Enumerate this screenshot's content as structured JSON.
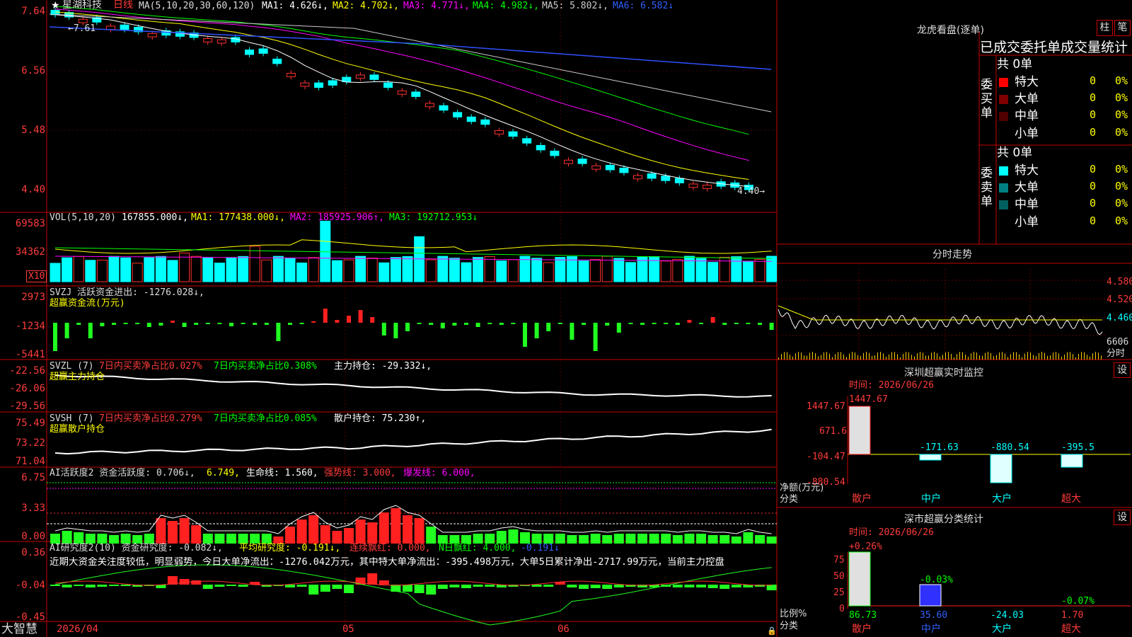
{
  "stock": {
    "name": "星湖科技",
    "period": "日线",
    "ma_label": "MA(5,10,20,30,60,120)",
    "ma1": "MA1: 4.626↓,",
    "ma2": "MA2: 4.702↓,",
    "ma3": "MA3: 4.771↓,",
    "ma4": "MA4: 4.982↓,",
    "ma5": "MA5: 5.802↓,",
    "ma6": "MA6: 6.582↓",
    "hi_marker": "←7.61",
    "last_marker": "4.40→",
    "ticks": [
      "7.64",
      "6.56",
      "5.48",
      "4.40"
    ]
  },
  "vol": {
    "label": "VOL(5,10,20)",
    "value": "167855.000↓,",
    "ma1": "MA1: 177438.000↓,",
    "ma2": "MA2: 185925.906↑,",
    "ma3": "MA3: 192712.953↓",
    "ticks": [
      "69583",
      "34362"
    ],
    "unit": "X10"
  },
  "svzj": {
    "label": "SVZJ  活跃资金进出: -1276.028↓,",
    "sub": "超赢资金流(万元)",
    "ticks": [
      "2973",
      "-1234",
      "-5441"
    ]
  },
  "svzl": {
    "l1": "SVZL (7)",
    "l2": "7日内买卖净占比0.027%",
    "l3": "7日内买卖净占比0.308%",
    "l4": "主力持仓: -29.332↓,",
    "sub": "超赢主力持仓",
    "ticks": [
      "-22.56",
      "-26.06",
      "-29.56"
    ]
  },
  "svsh": {
    "l1": "SVSH (7)",
    "l2": "7日内买卖净占比0.279%",
    "l3": "7日内买卖净占比0.085%",
    "l4": "散户持仓: 75.230↑,",
    "sub": "超赢散户持仓",
    "ticks": [
      "75.49",
      "73.22",
      "71.04"
    ]
  },
  "ai1": {
    "l1": "AI活跃度2 资金活跃度: 0.706↓,",
    "l2": "6.749,",
    "l3": "生命线: 1.560,",
    "l4": "强势线: 3.000,",
    "l5": "爆发线: 6.000,",
    "ticks": [
      "6.75",
      "3.33",
      "0.00"
    ]
  },
  "ai2": {
    "l1": "AI研究度2(10) 资金研究度: -0.082↓,",
    "l2": "平均研究度: -0.191↓,",
    "l3": "连续飘红: 0.000,",
    "l4": "N日飘红: 4.000,",
    "l5": "-0.191↓",
    "comment": "近期大资金关注度较低，明显弱势，今日大单净流出：-1276.042万元，其中特大单净流出：-395.498万元，大单5日累计净出-2717.99万元，当前主力控盘",
    "ticks": [
      "0.36",
      "-0.04",
      "-0.45"
    ]
  },
  "xaxis": {
    "brand": "大智慧",
    "d1": "2026/04",
    "d2": "05",
    "d3": "06"
  },
  "lhb": {
    "title": "龙虎看盘(逐单)",
    "btn1": "柱",
    "btn2": "笔",
    "header": "已成交委托单成交量统计",
    "buy_total": "共 0单",
    "sell_total": "共 0单",
    "buy_side": "委买单",
    "sell_side": "委卖单",
    "rows": [
      {
        "name": "特大",
        "n": "0",
        "p": "0%"
      },
      {
        "name": "大单",
        "n": "0",
        "p": "0%"
      },
      {
        "name": "中单",
        "n": "0",
        "p": "0%"
      },
      {
        "name": "小单",
        "n": "0",
        "p": "0%"
      }
    ]
  },
  "intraday": {
    "title": "分时走势",
    "ticks": [
      "4.580",
      "4.520",
      "4.460",
      "6606"
    ],
    "unit": "分时"
  },
  "sz_monitor": {
    "title": "深圳超赢实时监控",
    "btn": "设",
    "time": "时间: 2026/06/26",
    "yl": [
      "1447.67",
      "671.6",
      "-104.47",
      "-880.54"
    ],
    "ylabel1": "净额(万元)",
    "ylabel2": "分类",
    "cats": [
      "散户",
      "中户",
      "大户",
      "超大"
    ],
    "vals_text": [
      "1447.67",
      "-171.63",
      "-880.54",
      "-395.5"
    ]
  },
  "sz_class": {
    "title": "深市超赢分类统计",
    "btn": "设",
    "time": "时间: 2026/06/26",
    "yl": [
      "75",
      "50",
      "25",
      "0"
    ],
    "ylabel1": "比例%",
    "ylabel2": "分类",
    "top": [
      "+0.26%",
      "-0.03%",
      "-0.07%"
    ],
    "bot": [
      "86.73",
      "35.60",
      "-24.03",
      "1.70"
    ],
    "cats": [
      "散户",
      "中户",
      "大户",
      "超大"
    ]
  },
  "chart_data": [
    {
      "type": "candlestick",
      "title": "星湖科技 日线",
      "ylim": [
        4.4,
        7.64
      ],
      "close_series": [
        7.48,
        7.44,
        7.4,
        7.35,
        7.28,
        7.22,
        7.18,
        7.15,
        7.12,
        7.1,
        7.08,
        7.06,
        7.04,
        7.0,
        6.78,
        6.8,
        6.62,
        6.45,
        6.28,
        6.2,
        6.24,
        6.3,
        6.42,
        6.34,
        6.2,
        6.14,
        6.04,
        5.92,
        5.8,
        5.68,
        5.6,
        5.55,
        5.44,
        5.34,
        5.22,
        5.1,
        5.0,
        4.92,
        4.86,
        4.82,
        4.75,
        4.7,
        4.65,
        4.6,
        4.56,
        4.52,
        4.5,
        4.48,
        4.46,
        4.44,
        4.4
      ]
    },
    {
      "type": "bar",
      "title": "VOL",
      "ylim": [
        0,
        69583
      ]
    },
    {
      "type": "bar",
      "title": "超赢资金流(万元)",
      "ylim": [
        -5441,
        2973
      ]
    },
    {
      "type": "line",
      "title": "超赢主力持仓",
      "ylim": [
        -29.56,
        -22.56
      ]
    },
    {
      "type": "line",
      "title": "超赢散户持仓",
      "ylim": [
        71.04,
        75.49
      ]
    },
    {
      "type": "bar",
      "title": "AI活跃度2",
      "ylim": [
        0,
        6.75
      ]
    },
    {
      "type": "bar",
      "title": "AI研究度2(10)",
      "ylim": [
        -0.45,
        0.36
      ]
    },
    {
      "type": "bar",
      "title": "深圳超赢实时监控",
      "categories": [
        "散户",
        "中户",
        "大户",
        "超大"
      ],
      "values": [
        1447.67,
        -171.63,
        -880.54,
        -395.5
      ]
    },
    {
      "type": "bar",
      "title": "深市超赢分类统计",
      "categories": [
        "散户",
        "中户",
        "大户",
        "超大"
      ],
      "values": [
        86.73,
        35.6,
        -24.03,
        1.7
      ]
    }
  ]
}
